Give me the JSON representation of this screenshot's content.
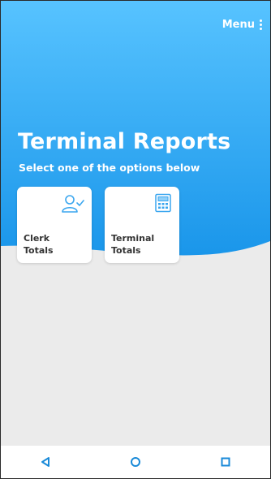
{
  "header": {
    "menu_label": "Menu",
    "menu_icon": "kebab-vertical-icon"
  },
  "hero": {
    "title": "Terminal Reports",
    "subtitle": "Select one of the options below",
    "gradient_top": "#57c3ff",
    "gradient_bottom": "#1a96ea"
  },
  "options": {
    "clerk": {
      "line1": "Clerk",
      "line2": "Totals",
      "icon": "user-check-icon"
    },
    "terminal": {
      "line1": "Terminal",
      "line2": "Totals",
      "icon": "calculator-icon"
    }
  },
  "navbar": {
    "back_icon": "triangle-back-icon",
    "home_icon": "circle-home-icon",
    "recents_icon": "square-recents-icon",
    "icon_color": "#1a8ad8"
  },
  "colors": {
    "accent": "#1a96ea",
    "background": "#ebebeb"
  }
}
